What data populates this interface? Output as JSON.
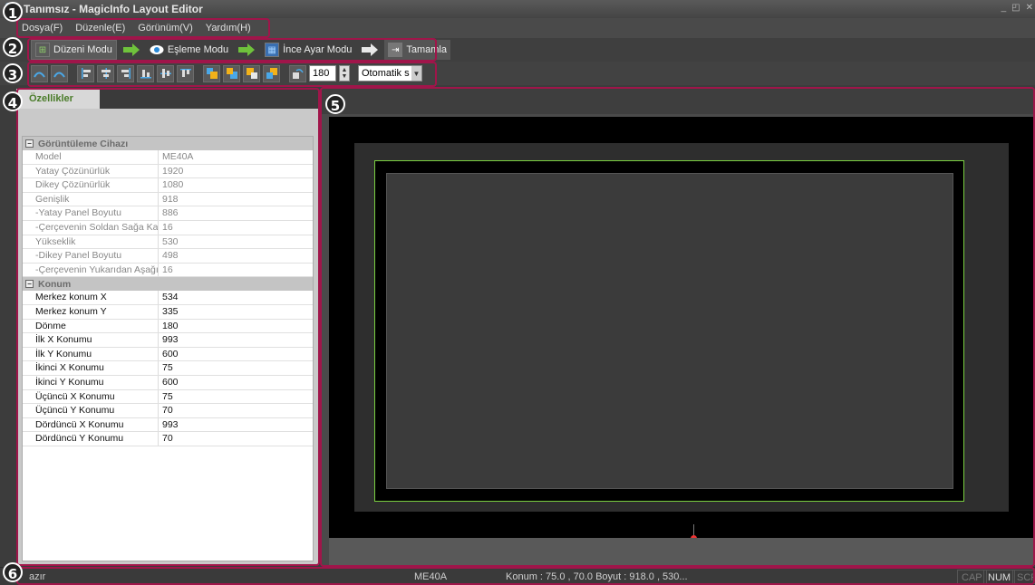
{
  "window": {
    "title": "Tanımsız - MagicInfo Layout Editor"
  },
  "menu": [
    "Dosya(F)",
    "Düzenle(E)",
    "Görünüm(V)",
    "Yardım(H)"
  ],
  "modes": [
    {
      "label": "Düzeni Modu",
      "icon": "layout-grid-icon"
    },
    {
      "label": "Eşleme Modu",
      "icon": "eye-icon"
    },
    {
      "label": "İnce Ayar Modu",
      "icon": "fine-tune-icon"
    },
    {
      "label": "Tamamla",
      "icon": "finish-icon"
    }
  ],
  "toolbar": {
    "rotation_value": "180",
    "scale_select": "Otomatik s"
  },
  "properties": {
    "tab_label": "Özellikler",
    "device_category": "Görüntüleme Cihazı",
    "device_rows": [
      {
        "k": "Model",
        "v": "ME40A"
      },
      {
        "k": "Yatay Çözünürlük",
        "v": "1920"
      },
      {
        "k": "Dikey Çözünürlük",
        "v": "1080"
      },
      {
        "k": "Genişlik",
        "v": "918"
      },
      {
        "k": "-Yatay Panel Boyutu",
        "v": "886"
      },
      {
        "k": "-Çerçevenin Soldan Sağa Kalınlı",
        "v": "16"
      },
      {
        "k": "Yükseklik",
        "v": "530"
      },
      {
        "k": "-Dikey Panel Boyutu",
        "v": "498"
      },
      {
        "k": "-Çerçevenin Yukarıdan Aşağıya",
        "v": "16"
      }
    ],
    "position_category": "Konum",
    "position_rows": [
      {
        "k": "Merkez konum X",
        "v": "534"
      },
      {
        "k": "Merkez konum Y",
        "v": "335"
      },
      {
        "k": "Dönme",
        "v": "180"
      },
      {
        "k": "İlk X Konumu",
        "v": "993"
      },
      {
        "k": "İlk Y Konumu",
        "v": "600"
      },
      {
        "k": "İkinci X Konumu",
        "v": "75"
      },
      {
        "k": "İkinci Y Konumu",
        "v": "600"
      },
      {
        "k": "Üçüncü X Konumu",
        "v": "75"
      },
      {
        "k": "Üçüncü Y Konumu",
        "v": "70"
      },
      {
        "k": "Dördüncü X Konumu",
        "v": "993"
      },
      {
        "k": "Dördüncü Y Konumu",
        "v": "70"
      }
    ]
  },
  "status": {
    "left": "azır",
    "device": "ME40A",
    "position": "Konum : 75.0 , 70.0   Boyut : 918.0 , 530...",
    "indicators": [
      "CAP",
      "NUM",
      "SCR"
    ]
  },
  "callouts": [
    "1",
    "2",
    "3",
    "4",
    "5",
    "6"
  ],
  "colors": {
    "callout_border": "#a0154a",
    "tab_text": "#4a7c2a",
    "device_outline": "#7ad040",
    "pin": "#e33333"
  }
}
